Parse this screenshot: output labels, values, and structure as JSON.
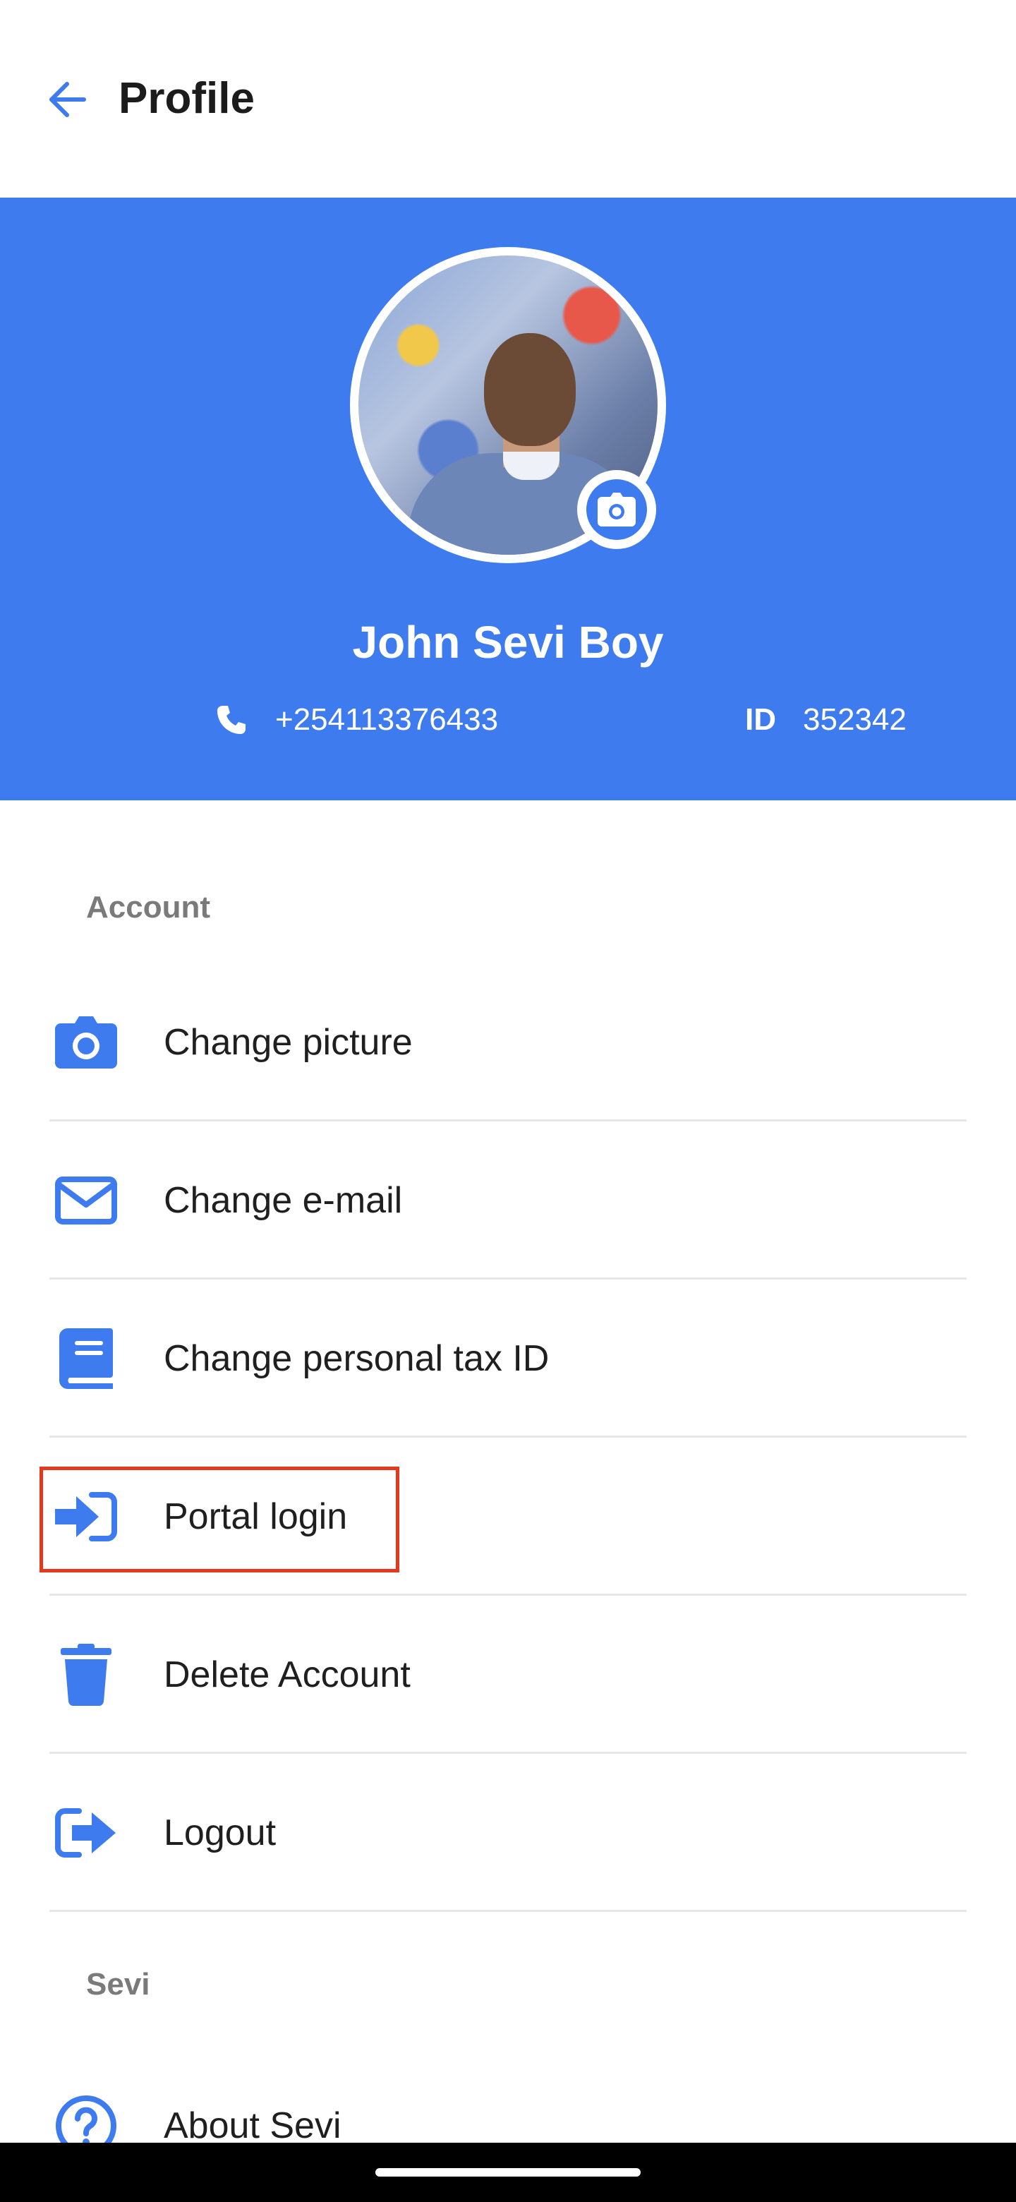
{
  "header": {
    "title": "Profile",
    "back_icon": "arrow-left-icon"
  },
  "profile": {
    "name": "John Sevi Boy",
    "phone": "+254113376433",
    "id_label": "ID",
    "id_value": "352342",
    "camera_badge_icon": "camera-icon"
  },
  "sections": {
    "account_title": "Account",
    "sevi_title": "Sevi"
  },
  "menu": {
    "change_picture": "Change picture",
    "change_email": "Change e-mail",
    "change_tax_id": "Change personal tax ID",
    "portal_login": "Portal login",
    "delete_account": "Delete Account",
    "logout": "Logout",
    "about": "About Sevi"
  },
  "colors": {
    "accent": "#3d7bef",
    "highlight": "#e5391f",
    "section_text": "#7a7a7a"
  }
}
